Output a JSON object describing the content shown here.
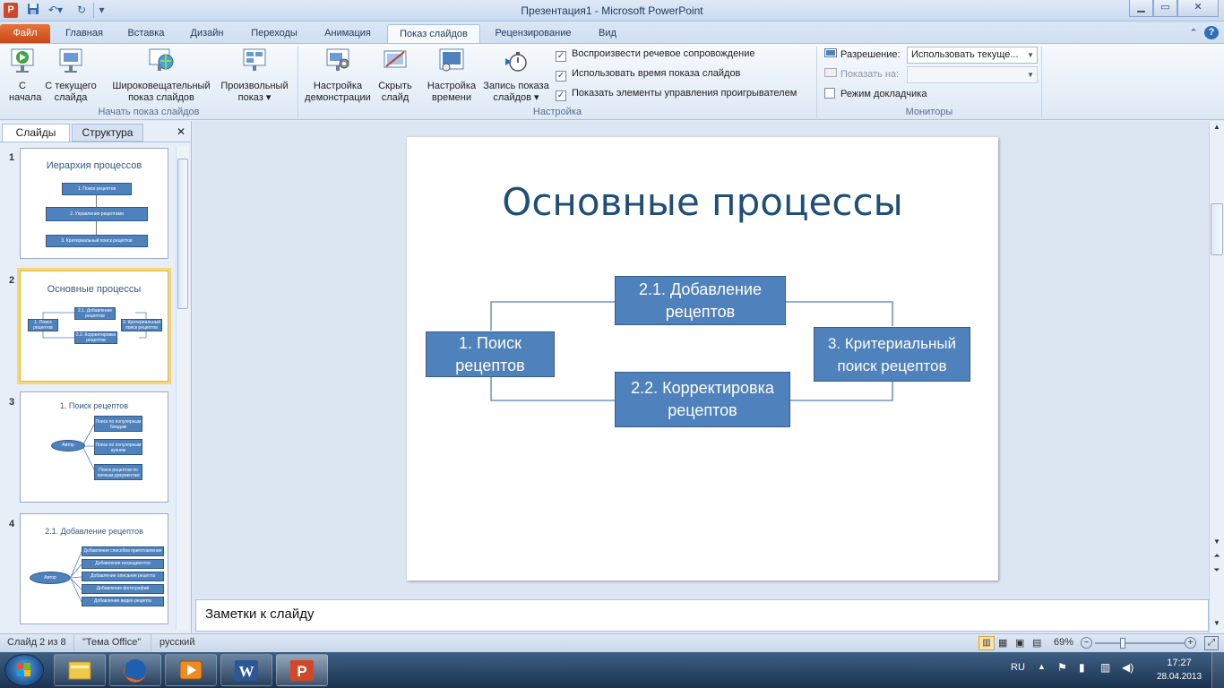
{
  "window": {
    "title": "Презентация1  -  Microsoft PowerPoint",
    "app_icon": "P",
    "quick_access": [
      "save-icon",
      "undo-icon",
      "redo-icon",
      "customize-icon"
    ],
    "controls": [
      "minimize",
      "maximize",
      "close"
    ]
  },
  "tabs": [
    {
      "label": "Файл"
    },
    {
      "label": "Главная"
    },
    {
      "label": "Вставка"
    },
    {
      "label": "Дизайн"
    },
    {
      "label": "Переходы"
    },
    {
      "label": "Анимация"
    },
    {
      "label": "Показ слайдов"
    },
    {
      "label": "Рецензирование"
    },
    {
      "label": "Вид"
    }
  ],
  "ribbon": {
    "group_start": {
      "label": "Начать показ слайдов",
      "from_start": "С начала",
      "from_current_1": "С текущего",
      "from_current_2": "слайда",
      "broadcast_1": "Широковещательный",
      "broadcast_2": "показ слайдов",
      "custom_1": "Произвольный",
      "custom_2": "показ ▾"
    },
    "group_setup": {
      "label": "Настройка",
      "setup_1": "Настройка",
      "setup_2": "демонстрации",
      "hide_1": "Скрыть",
      "hide_2": "слайд",
      "timing_1": "Настройка",
      "timing_2": "времени",
      "record_1": "Запись показа",
      "record_2": "слайдов ▾",
      "opt_narration": "Воспроизвести речевое сопровождение",
      "opt_timings": "Использовать время показа слайдов",
      "opt_media_controls": "Показать элементы управления проигрывателем"
    },
    "group_monitors": {
      "label": "Мониторы",
      "resolution_label": "Разрешение:",
      "resolution_value": "Использовать текуще...",
      "show_on_label": "Показать на:",
      "show_on_value": "",
      "presenter_view": "Режим докладчика"
    }
  },
  "left_pane": {
    "tab_slides": "Слайды",
    "tab_outline": "Структура",
    "thumbnails": [
      {
        "num": "1",
        "title": "Иерархия процессов",
        "boxes": [
          "1. Поиск  рецептов",
          "2. Управление рецептами",
          "3. Критериальный поиск рецептов"
        ]
      },
      {
        "num": "2",
        "title": "Основные процессы",
        "boxes": [
          "1. Поиск рецептов",
          "2.1. Добавление рецептов",
          "2.2. Корректировка рецептов",
          "3. Критериальный поиск рецептов"
        ]
      },
      {
        "num": "3",
        "title": "1. Поиск рецептов",
        "actor": "Автор",
        "boxes": [
          "Поиск по популярным блюдам",
          "Поиск по популярным кухням",
          "Поиск рецептов по личным документам"
        ]
      },
      {
        "num": "4",
        "title": "2.1. Добавление рецептов",
        "actor": "Автор",
        "boxes": [
          "Добавление способов приготовления",
          "Добавление ингредиентов",
          "Добавление описания рецепта",
          "Добавление фотографий",
          "Добавление видео рецепта"
        ]
      }
    ]
  },
  "slide": {
    "title": "Основные процессы",
    "box_search": "1. Поиск рецептов",
    "box_add": "2.1. Добавление рецептов",
    "box_edit": "2.2. Корректировка рецептов",
    "box_criteria": "3. Критериальный поиск рецептов"
  },
  "notes_placeholder": "Заметки к слайду",
  "status": {
    "slide_info": "Слайд 2 из 8",
    "theme": "\"Тема Office\"",
    "language": "русский",
    "zoom": "69%"
  },
  "taskbar": {
    "language": "RU",
    "time": "17:27",
    "date": "28.04.2013",
    "apps": [
      "windows-explorer-icon",
      "firefox-icon",
      "media-player-icon",
      "word-icon",
      "powerpoint-icon"
    ]
  }
}
